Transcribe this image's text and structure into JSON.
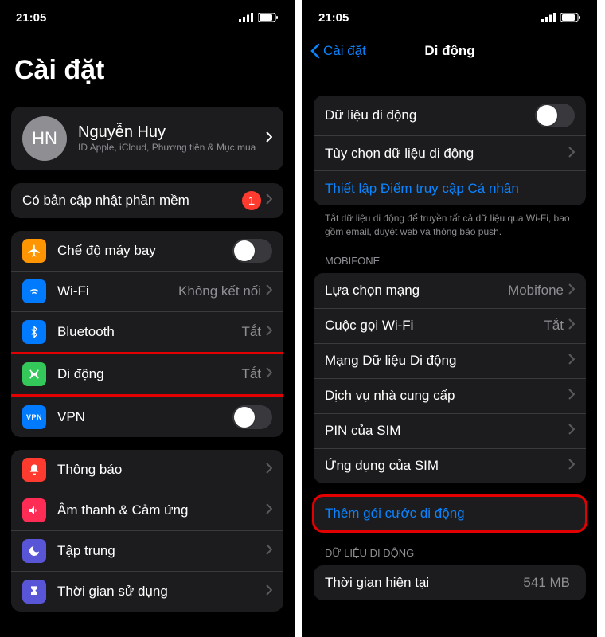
{
  "status": {
    "time": "21:05"
  },
  "left": {
    "title": "Cài đặt",
    "profile": {
      "initials": "HN",
      "name": "Nguyễn Huy",
      "sub": "ID Apple, iCloud, Phương tiện & Mục mua"
    },
    "update": {
      "label": "Có bản cập nhật phần mềm",
      "badge": "1"
    },
    "rows": {
      "airplane": "Chế độ máy bay",
      "wifi": "Wi-Fi",
      "wifi_val": "Không kết nối",
      "bt": "Bluetooth",
      "bt_val": "Tắt",
      "cellular": "Di động",
      "cellular_val": "Tắt",
      "vpn": "VPN",
      "notif": "Thông báo",
      "sound": "Âm thanh & Cảm ứng",
      "focus": "Tập trung",
      "screen": "Thời gian sử dụng"
    }
  },
  "right": {
    "back": "Cài đặt",
    "title": "Di động",
    "rows": {
      "data": "Dữ liệu di động",
      "options": "Tùy chọn dữ liệu di động",
      "hotspot": "Thiết lập Điểm truy cập Cá nhân",
      "footer": "Tắt dữ liệu di động để truyền tất cả dữ liệu qua Wi-Fi, bao gồm email, duyệt web và thông báo push.",
      "carrier_header": "MOBIFONE",
      "network": "Lựa chọn mạng",
      "network_val": "Mobifone",
      "wificall": "Cuộc gọi Wi-Fi",
      "wificall_val": "Tắt",
      "datanet": "Mạng Dữ liệu Di động",
      "services": "Dịch vụ nhà cung cấp",
      "simpin": "PIN của SIM",
      "simapp": "Ứng dụng của SIM",
      "addplan": "Thêm gói cước di động",
      "data_header": "DỮ LIỆU DI ĐỘNG",
      "current": "Thời gian hiện tại",
      "current_val": "541 MB"
    }
  }
}
